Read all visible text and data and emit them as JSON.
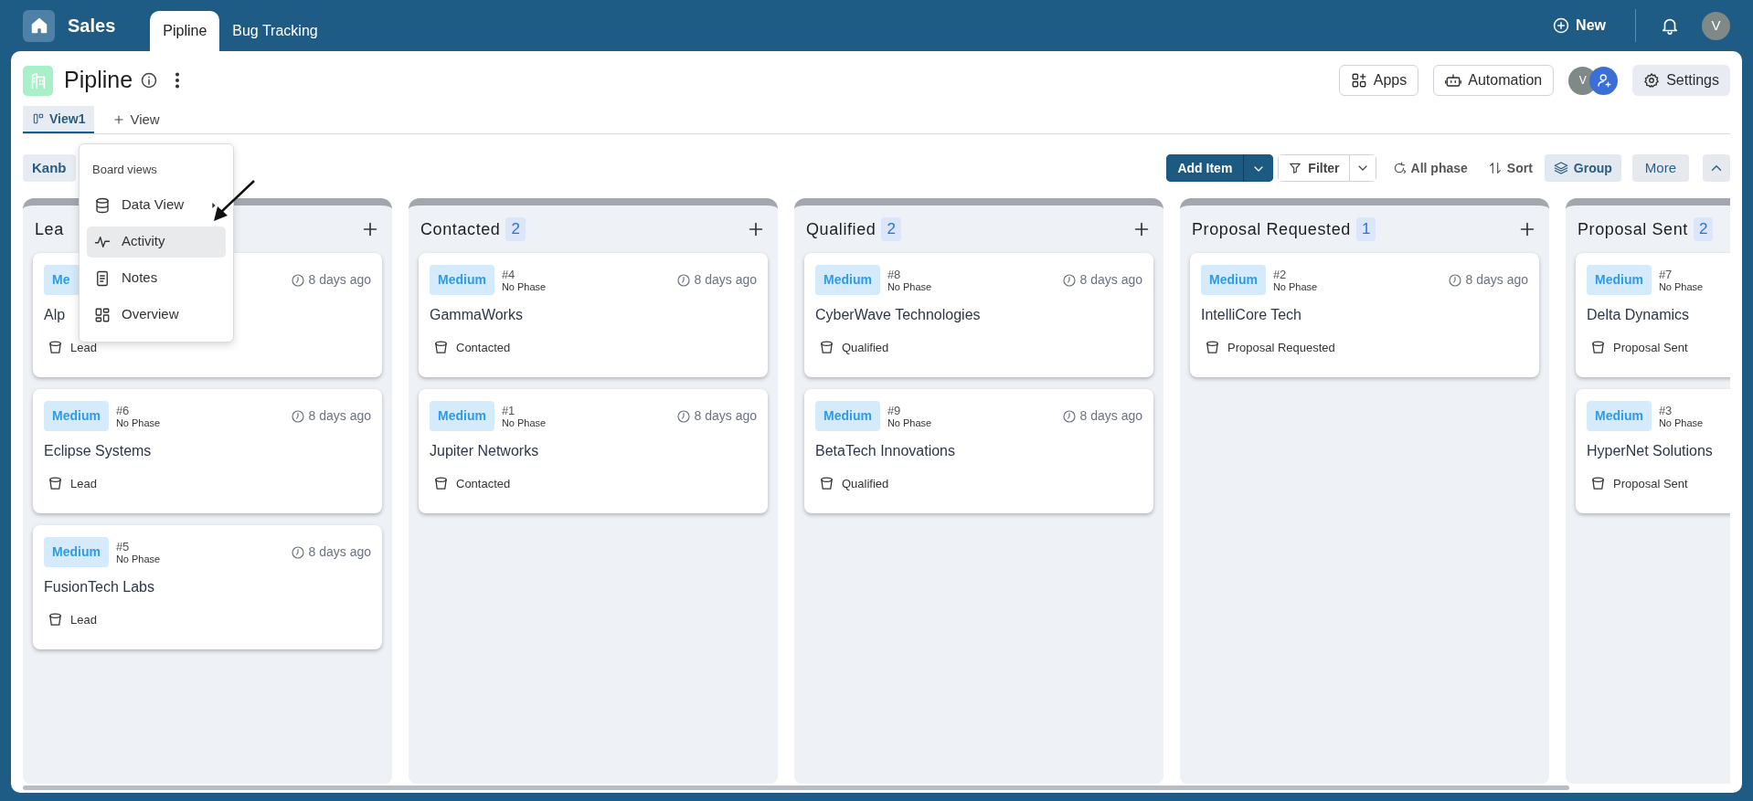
{
  "top_bar": {
    "app_title": "Sales",
    "tabs": [
      {
        "label": "Pipline",
        "selected": true
      },
      {
        "label": "Bug Tracking",
        "selected": false
      }
    ],
    "new_button": "New",
    "user_initial": "V"
  },
  "header": {
    "title": "Pipline",
    "apps_button": "Apps",
    "automation_button": "Automation",
    "member_initial": "V",
    "settings_button": "Settings"
  },
  "views": {
    "tabs": [
      {
        "label": "View1",
        "selected": true
      }
    ],
    "add_view": "View"
  },
  "toolbar": {
    "view_type": "Kanb",
    "add_item": "Add Item",
    "filter": "Filter",
    "phase": "All phase",
    "sort": "Sort",
    "group": "Group",
    "more": "More"
  },
  "columns": [
    {
      "title": "Lea",
      "add_visible": true,
      "cards": [
        {
          "priority": "Me",
          "name": "Alp",
          "time": "8 days ago",
          "stage": "Lead"
        },
        {
          "priority": "Medium",
          "number": "#6",
          "phase_note": "No Phase",
          "time": "8 days ago",
          "name": "Eclipse Systems",
          "stage": "Lead"
        },
        {
          "priority": "Medium",
          "number": "#5",
          "phase_note": "No Phase",
          "time": "8 days ago",
          "name": "FusionTech Labs",
          "stage": "Lead"
        }
      ]
    },
    {
      "title": "Contacted",
      "count": "2",
      "add_visible": true,
      "cards": [
        {
          "priority": "Medium",
          "number": "#4",
          "phase_note": "No Phase",
          "time": "8 days ago",
          "name": "GammaWorks",
          "stage": "Contacted"
        },
        {
          "priority": "Medium",
          "number": "#1",
          "phase_note": "No Phase",
          "time": "8 days ago",
          "name": "Jupiter Networks",
          "stage": "Contacted"
        }
      ]
    },
    {
      "title": "Qualified",
      "count": "2",
      "add_visible": true,
      "cards": [
        {
          "priority": "Medium",
          "number": "#8",
          "phase_note": "No Phase",
          "time": "8 days ago",
          "name": "CyberWave Technologies",
          "stage": "Qualified"
        },
        {
          "priority": "Medium",
          "number": "#9",
          "phase_note": "No Phase",
          "time": "8 days ago",
          "name": "BetaTech Innovations",
          "stage": "Qualified"
        }
      ]
    },
    {
      "title": "Proposal Requested",
      "count": "1",
      "add_visible": true,
      "cards": [
        {
          "priority": "Medium",
          "number": "#2",
          "phase_note": "No Phase",
          "time": "8 days ago",
          "name": "IntelliCore Tech",
          "stage": "Proposal Requested"
        }
      ]
    },
    {
      "title": "Proposal Sent",
      "count": "2",
      "add_visible": false,
      "cards": [
        {
          "priority": "Medium",
          "number": "#7",
          "phase_note": "No Phase",
          "name": "Delta Dynamics",
          "stage": "Proposal Sent"
        },
        {
          "priority": "Medium",
          "number": "#3",
          "phase_note": "No Phase",
          "name": "HyperNet Solutions",
          "stage": "Proposal Sent"
        }
      ]
    }
  ],
  "board_views_menu": {
    "title": "Board views",
    "items": [
      {
        "label": "Data View",
        "submenu": true,
        "selected": false
      },
      {
        "label": "Activity",
        "submenu": false,
        "selected": true
      },
      {
        "label": "Notes",
        "submenu": false,
        "selected": false
      },
      {
        "label": "Overview",
        "submenu": false,
        "selected": false
      }
    ]
  }
}
